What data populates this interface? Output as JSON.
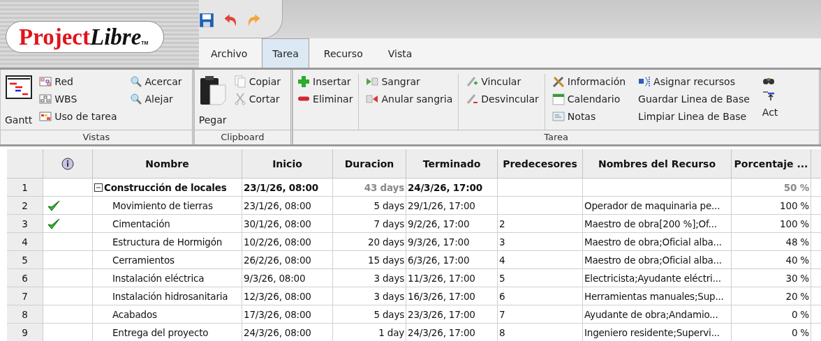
{
  "app": {
    "logo_part_1": "Project",
    "logo_part_2": "Libre",
    "logo_mark": "TM"
  },
  "tabs": [
    {
      "label": "Archivo",
      "selected": false
    },
    {
      "label": "Tarea",
      "selected": true
    },
    {
      "label": "Recurso",
      "selected": false
    },
    {
      "label": "Vista",
      "selected": false
    }
  ],
  "ribbon": {
    "groups": [
      {
        "title": "Vistas",
        "large": "Gantt",
        "columns": [
          [
            "Red",
            "WBS",
            "Uso de tarea"
          ],
          [
            "Acercar",
            "Alejar"
          ]
        ]
      },
      {
        "title": "Clipboard",
        "large": "Pegar",
        "columns": [
          [
            "Copiar",
            "Cortar"
          ]
        ]
      },
      {
        "title": "Tarea",
        "columns": [
          [
            "Insertar",
            "Eliminar"
          ],
          [
            "Sangrar",
            "Anular sangria"
          ],
          [
            "Vincular",
            "Desvincular"
          ],
          [
            "Información",
            "Calendario",
            "Notas"
          ],
          [
            "Asignar recursos",
            "Guardar Linea de Base",
            "Limpiar Linea de Base"
          ],
          [
            "Act"
          ]
        ]
      }
    ]
  },
  "table": {
    "columns": [
      "Nombre",
      "Inicio",
      "Duracion",
      "Terminado",
      "Predecesores",
      "Nombres del Recurso",
      "Porcentaje ..."
    ],
    "rows": [
      {
        "id": "1",
        "done": false,
        "summary": true,
        "expanded": true,
        "name": "Construcción de locales",
        "start": "23/1/26, 08:00",
        "duration": "43 days",
        "finish": "24/3/26, 17:00",
        "percent": "50 %"
      },
      {
        "id": "2",
        "done": true,
        "summary": false,
        "name": "Movimiento de tierras",
        "start": "23/1/26, 08:00",
        "duration": "5 days",
        "finish": "29/1/26, 17:00",
        "resources": "Operador de maquinaria pe...",
        "percent": "100 %"
      },
      {
        "id": "3",
        "done": true,
        "summary": false,
        "name": "Cimentación",
        "start": "30/1/26, 08:00",
        "duration": "7 days",
        "finish": "9/2/26, 17:00",
        "predecessors": "2",
        "resources": "Maestro de obra[200 %];Of...",
        "percent": "100 %"
      },
      {
        "id": "4",
        "done": false,
        "summary": false,
        "name": "Estructura de Hormigón",
        "start": "10/2/26, 08:00",
        "duration": "20 days",
        "finish": "9/3/26, 17:00",
        "predecessors": "3",
        "resources": "Maestro de obra;Oficial alba...",
        "percent": "48 %"
      },
      {
        "id": "5",
        "done": false,
        "summary": false,
        "name": "Cerramientos",
        "start": "26/2/26, 08:00",
        "duration": "15 days",
        "finish": "6/3/26, 17:00",
        "predecessors": "4",
        "resources": "Maestro de obra;Oficial alba...",
        "percent": "40 %"
      },
      {
        "id": "6",
        "done": false,
        "summary": false,
        "name": "Instalación eléctrica",
        "start": "9/3/26, 08:00",
        "duration": "3 days",
        "finish": "11/3/26, 17:00",
        "predecessors": "5",
        "resources": "Electricista;Ayudante eléctri...",
        "percent": "30 %"
      },
      {
        "id": "7",
        "done": false,
        "summary": false,
        "name": "Instalación hidrosanitaria",
        "start": "12/3/26, 08:00",
        "duration": "3 days",
        "finish": "16/3/26, 17:00",
        "predecessors": "6",
        "resources": "Herramientas manuales;Sup...",
        "percent": "20 %"
      },
      {
        "id": "8",
        "done": false,
        "summary": false,
        "name": "Acabados",
        "start": "17/3/26, 08:00",
        "duration": "5 days",
        "finish": "23/3/26, 17:00",
        "predecessors": "7",
        "resources": "Ayudante de obra;Andamio...",
        "percent": "0 %"
      },
      {
        "id": "9",
        "done": false,
        "summary": false,
        "name": "Entrega del proyecto",
        "start": "24/3/26, 08:00",
        "duration": "1 day",
        "finish": "24/3/26, 17:00",
        "predecessors": "8",
        "resources": "Ingeniero residente;Supervi...",
        "percent": "0 %"
      }
    ]
  }
}
